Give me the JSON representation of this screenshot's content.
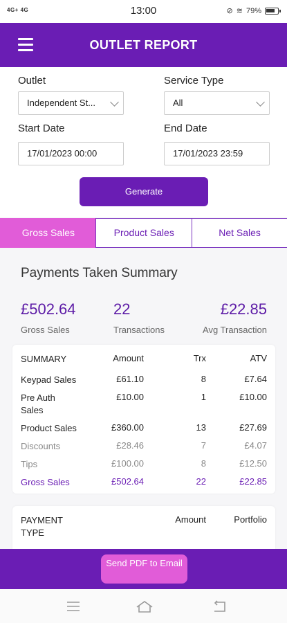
{
  "status": {
    "left": "4G+ 4G",
    "time": "13:00",
    "battery": "79%"
  },
  "header": {
    "title": "OUTLET REPORT"
  },
  "form": {
    "outlet_label": "Outlet",
    "outlet_value": "Independent St...",
    "service_label": "Service Type",
    "service_value": "All",
    "start_label": "Start Date",
    "start_value": "17/01/2023 00:00",
    "end_label": "End Date",
    "end_value": "17/01/2023 23:59",
    "generate": "Generate"
  },
  "tabs": [
    "Gross Sales",
    "Product Sales",
    "Net Sales"
  ],
  "summary": {
    "heading": "Payments Taken Summary",
    "gross_value": "£502.64",
    "gross_label": "Gross Sales",
    "trx_value": "22",
    "trx_label": "Transactions",
    "avg_value": "£22.85",
    "avg_label": "Avg Transaction"
  },
  "table": {
    "headers": [
      "SUMMARY",
      "Amount",
      "Trx",
      "ATV"
    ],
    "rows": [
      {
        "name": "Keypad Sales",
        "amount": "£61.10",
        "trx": "8",
        "atv": "£7.64"
      },
      {
        "name": "Pre Auth Sales",
        "amount": "£10.00",
        "trx": "1",
        "atv": "£10.00"
      },
      {
        "name": "Product Sales",
        "amount": "£360.00",
        "trx": "13",
        "atv": "£27.69"
      },
      {
        "name": "Discounts",
        "amount": "£28.46",
        "trx": "7",
        "atv": "£4.07"
      },
      {
        "name": "Tips",
        "amount": "£100.00",
        "trx": "8",
        "atv": "£12.50"
      },
      {
        "name": "Gross Sales",
        "amount": "£502.64",
        "trx": "22",
        "atv": "£22.85"
      }
    ]
  },
  "payment": {
    "type_label": "PAYMENT TYPE",
    "amount_label": "Amount",
    "portfolio_label": "Portfolio"
  },
  "bottom": {
    "send_pdf": "Send PDF to Email"
  },
  "colors": {
    "primary": "#6a1db4",
    "accent": "#e15cd8"
  }
}
